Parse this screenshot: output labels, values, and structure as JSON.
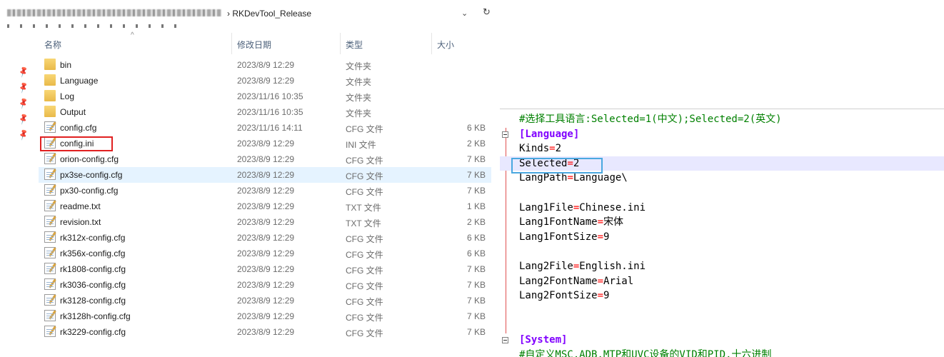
{
  "address": {
    "path_tail": "› RKDevTool_Release",
    "dropdown_icon": "chevron-down-icon",
    "refresh_icon": "refresh-icon"
  },
  "columns": {
    "name": "名称",
    "date": "修改日期",
    "type": "类型",
    "size": "大小"
  },
  "files": [
    {
      "name": "bin",
      "date": "2023/8/9 12:29",
      "type": "文件夹",
      "size": "",
      "kind": "folder"
    },
    {
      "name": "Language",
      "date": "2023/8/9 12:29",
      "type": "文件夹",
      "size": "",
      "kind": "folder"
    },
    {
      "name": "Log",
      "date": "2023/11/16 10:35",
      "type": "文件夹",
      "size": "",
      "kind": "folder"
    },
    {
      "name": "Output",
      "date": "2023/11/16 10:35",
      "type": "文件夹",
      "size": "",
      "kind": "folder"
    },
    {
      "name": "config.cfg",
      "date": "2023/11/16 14:11",
      "type": "CFG 文件",
      "size": "6 KB",
      "kind": "file"
    },
    {
      "name": "config.ini",
      "date": "2023/8/9 12:29",
      "type": "INI 文件",
      "size": "2 KB",
      "kind": "file"
    },
    {
      "name": "orion-config.cfg",
      "date": "2023/8/9 12:29",
      "type": "CFG 文件",
      "size": "7 KB",
      "kind": "file"
    },
    {
      "name": "px3se-config.cfg",
      "date": "2023/8/9 12:29",
      "type": "CFG 文件",
      "size": "7 KB",
      "kind": "file"
    },
    {
      "name": "px30-config.cfg",
      "date": "2023/8/9 12:29",
      "type": "CFG 文件",
      "size": "7 KB",
      "kind": "file"
    },
    {
      "name": "readme.txt",
      "date": "2023/8/9 12:29",
      "type": "TXT 文件",
      "size": "1 KB",
      "kind": "file"
    },
    {
      "name": "revision.txt",
      "date": "2023/8/9 12:29",
      "type": "TXT 文件",
      "size": "2 KB",
      "kind": "file"
    },
    {
      "name": "rk312x-config.cfg",
      "date": "2023/8/9 12:29",
      "type": "CFG 文件",
      "size": "6 KB",
      "kind": "file"
    },
    {
      "name": "rk356x-config.cfg",
      "date": "2023/8/9 12:29",
      "type": "CFG 文件",
      "size": "6 KB",
      "kind": "file"
    },
    {
      "name": "rk1808-config.cfg",
      "date": "2023/8/9 12:29",
      "type": "CFG 文件",
      "size": "7 KB",
      "kind": "file"
    },
    {
      "name": "rk3036-config.cfg",
      "date": "2023/8/9 12:29",
      "type": "CFG 文件",
      "size": "7 KB",
      "kind": "file"
    },
    {
      "name": "rk3128-config.cfg",
      "date": "2023/8/9 12:29",
      "type": "CFG 文件",
      "size": "7 KB",
      "kind": "file"
    },
    {
      "name": "rk3128h-config.cfg",
      "date": "2023/8/9 12:29",
      "type": "CFG 文件",
      "size": "7 KB",
      "kind": "file"
    },
    {
      "name": "rk3229-config.cfg",
      "date": "2023/8/9 12:29",
      "type": "CFG 文件",
      "size": "7 KB",
      "kind": "file"
    }
  ],
  "selected_file": "px3se-config.cfg",
  "highlighted_file": "config.ini",
  "editor": {
    "lines": [
      {
        "kind": "comment",
        "text": "#选择工具语言:Selected=1(中文);Selected=2(英文)"
      },
      {
        "kind": "section",
        "text": "[Language]",
        "fold": true
      },
      {
        "kind": "kv",
        "key": "Kinds",
        "value": "2"
      },
      {
        "kind": "kv",
        "key": "Selected",
        "value": "2",
        "highlight": true
      },
      {
        "kind": "kv",
        "key": "LangPath",
        "value": "Language\\"
      },
      {
        "kind": "blank"
      },
      {
        "kind": "kv",
        "key": "Lang1File",
        "value": "Chinese.ini"
      },
      {
        "kind": "kv",
        "key": "Lang1FontName",
        "value": "宋体"
      },
      {
        "kind": "kv",
        "key": "Lang1FontSize",
        "value": "9"
      },
      {
        "kind": "blank"
      },
      {
        "kind": "kv",
        "key": "Lang2File",
        "value": "English.ini"
      },
      {
        "kind": "kv",
        "key": "Lang2FontName",
        "value": "Arial"
      },
      {
        "kind": "kv",
        "key": "Lang2FontSize",
        "value": "9"
      },
      {
        "kind": "blank"
      },
      {
        "kind": "blank"
      },
      {
        "kind": "section",
        "text": "[System]",
        "fold": true
      },
      {
        "kind": "comment",
        "text": "#自定义MSC,ADB,MTP和UVC设备的VID和PID,十六进制"
      }
    ]
  },
  "colors": {
    "comment": "#008000",
    "section": "#8000ff",
    "equals": "#ff0000",
    "red_box": "#e02020",
    "blue_box": "#4aa8e0"
  }
}
